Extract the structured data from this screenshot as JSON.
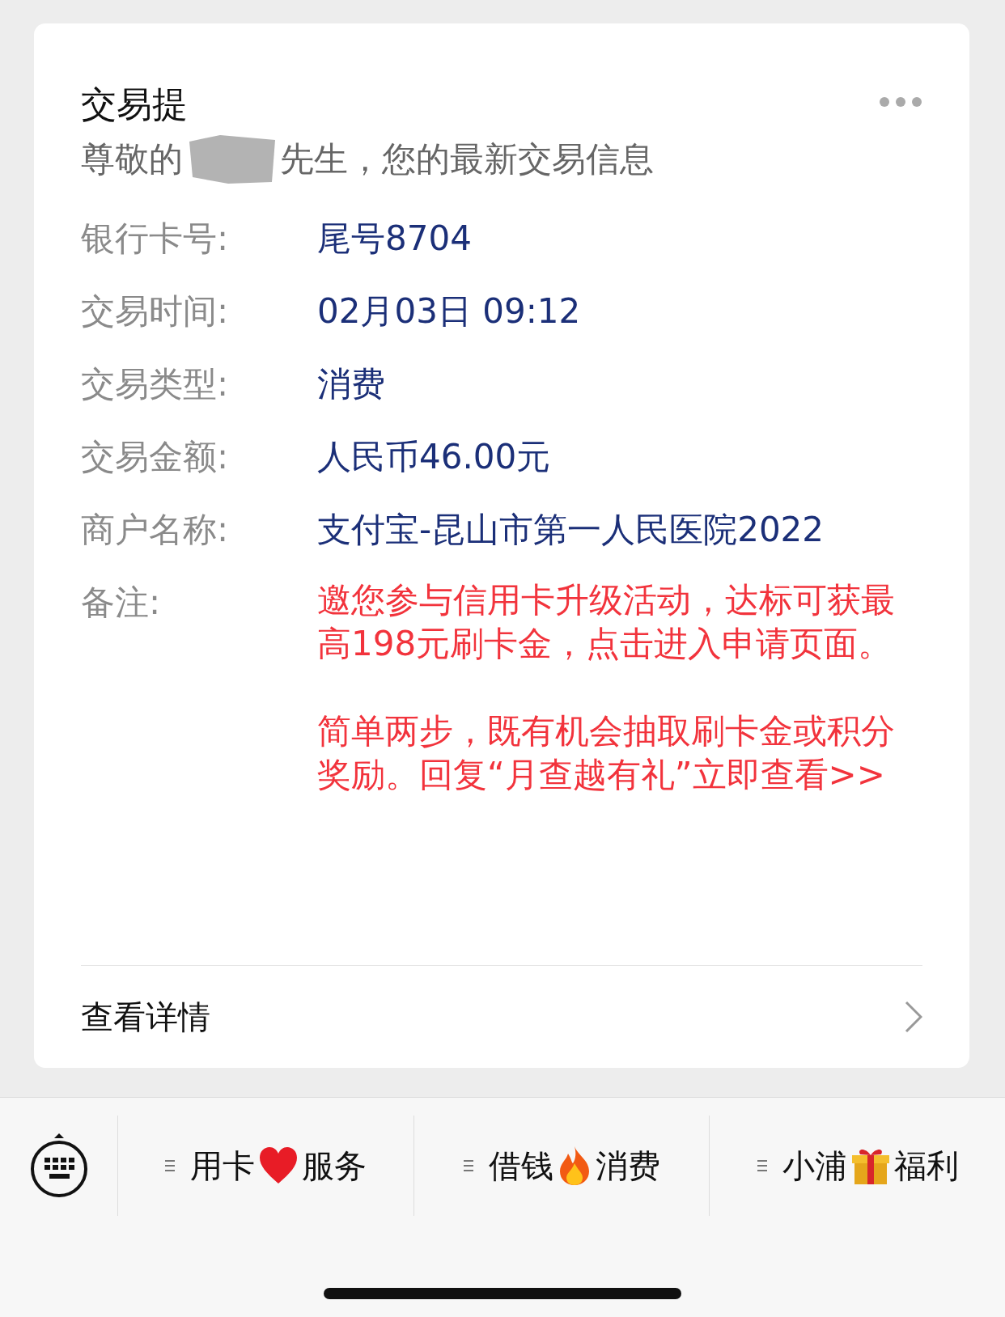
{
  "card": {
    "title": "交易提",
    "greeting_before": "尊敬的",
    "greeting_after": "先生，您的最新交易信息",
    "fields": [
      {
        "label": "银行卡号:",
        "value": "尾号8704",
        "kind": "info"
      },
      {
        "label": "交易时间:",
        "value": "02月03日 09:12",
        "kind": "info"
      },
      {
        "label": "交易类型:",
        "value": "消费",
        "kind": "info"
      },
      {
        "label": "交易金额:",
        "value": "人民币46.00元",
        "kind": "info"
      },
      {
        "label": "商户名称:",
        "value": "支付宝-昆山市第一人民医院2022",
        "kind": "info"
      },
      {
        "label": "备注:",
        "paragraphs": [
          "邀您参与信用卡升级活动，达标可获最高198元刷卡金，点击进入申请页面。",
          "简单两步，既有机会抽取刷卡金或积分奖励。回复“月查越有礼”立即查看>>"
        ],
        "kind": "remark"
      }
    ],
    "link": "查看详情"
  },
  "menu": [
    {
      "before": "用卡",
      "kind": "heart",
      "after": "服务"
    },
    {
      "before": "借钱",
      "kind": "flame",
      "after": "消费"
    },
    {
      "before": "小浦",
      "kind": "gift",
      "after": "福利"
    }
  ]
}
